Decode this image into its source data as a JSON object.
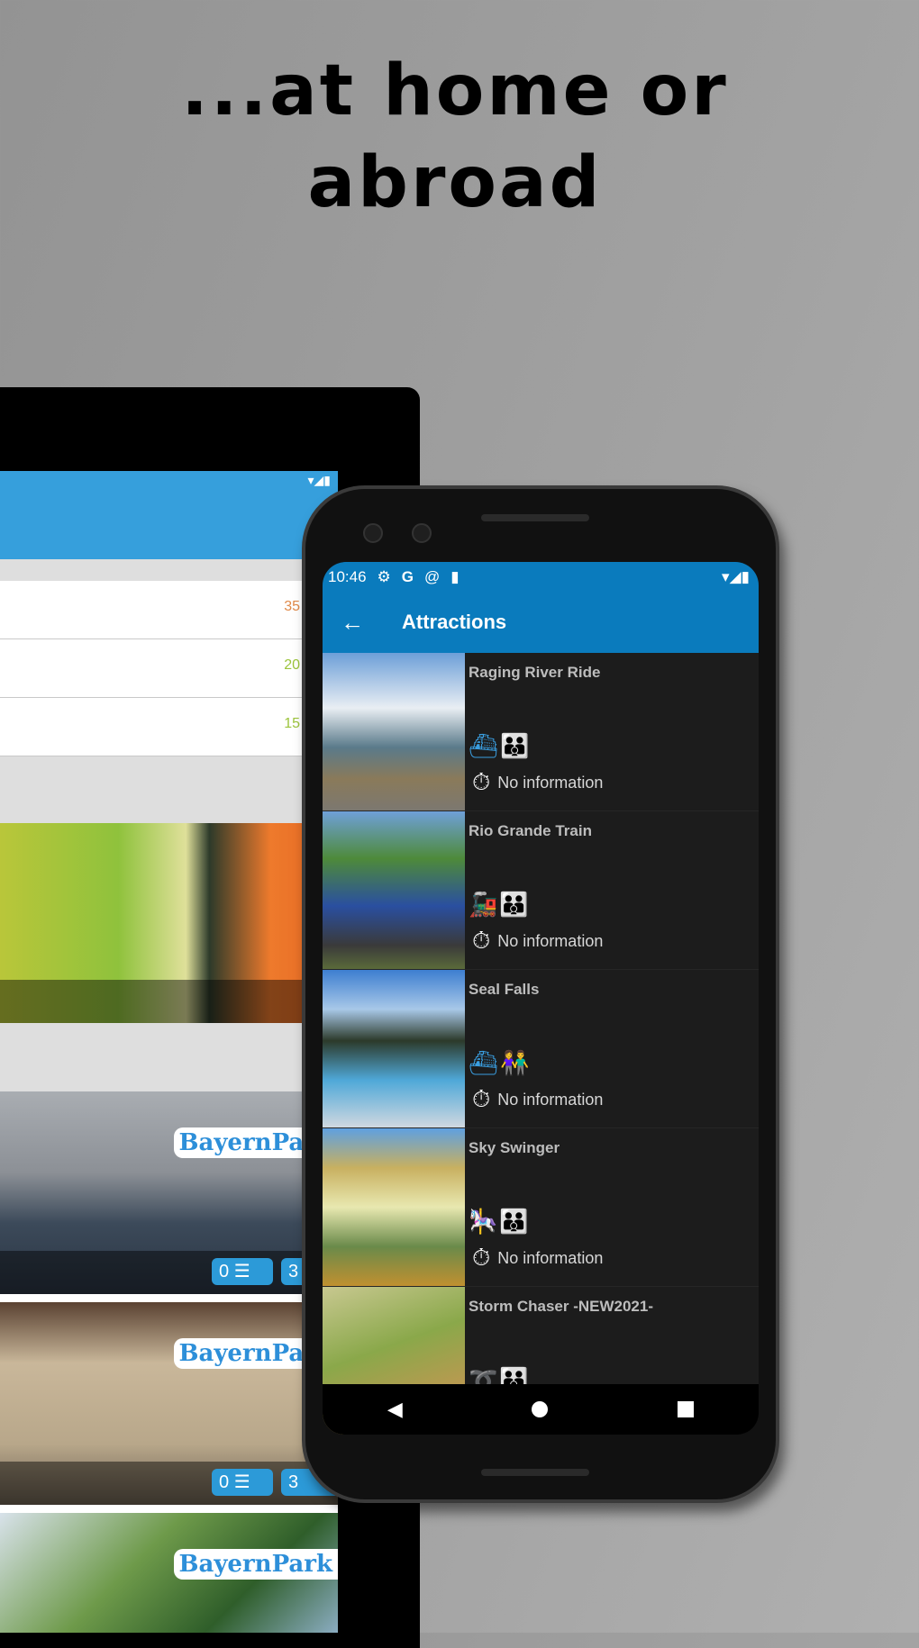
{
  "headline": {
    "line1": "...at home or",
    "line2": "abroad"
  },
  "tablet": {
    "rows": [
      {
        "value": "35",
        "color": "#e08a4a"
      },
      {
        "value": "20",
        "color": "#9cc43c"
      },
      {
        "value": "15",
        "color": "#9cc43c"
      }
    ],
    "cards": [
      {
        "comments": "0",
        "likes": "3"
      },
      {
        "comments": "0",
        "likes": "3"
      }
    ],
    "logo": "BayernPark"
  },
  "phone": {
    "status": {
      "time": "10:46",
      "icons": [
        "gear-icon",
        "google-icon",
        "sync-icon",
        "sd-card-icon",
        "wifi-icon",
        "signal-icon",
        "battery-icon"
      ]
    },
    "title": "Attractions",
    "accent": "#0a7bbd",
    "attractions": [
      {
        "name": "Raging River Ride",
        "type": "water-ride-icon",
        "audience": "family-icon",
        "wait": "No information"
      },
      {
        "name": "Rio Grande Train",
        "type": "train-icon",
        "audience": "family-icon",
        "wait": "No information"
      },
      {
        "name": "Seal Falls",
        "type": "water-ride-icon",
        "audience": "kids-icon",
        "wait": "No information"
      },
      {
        "name": "Sky Swinger",
        "type": "carousel-icon",
        "audience": "family-icon",
        "wait": "No information"
      },
      {
        "name": "Storm Chaser -NEW2021-",
        "type": "coaster-icon",
        "audience": "family-icon",
        "wait": ""
      }
    ]
  }
}
